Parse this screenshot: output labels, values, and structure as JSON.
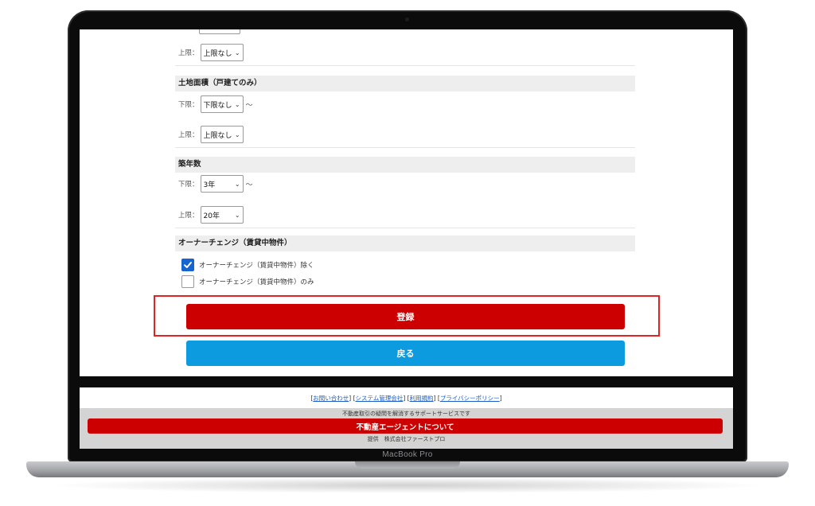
{
  "device": {
    "label": "MacBook Pro"
  },
  "form": {
    "top_row": {
      "label": "上限：",
      "value": "上限なし"
    },
    "land_area": {
      "heading": "土地面積（戸建てのみ）",
      "lower": {
        "label": "下限：",
        "value": "下限なし",
        "suffix": "〜"
      },
      "upper": {
        "label": "上限：",
        "value": "上限なし"
      }
    },
    "building_age": {
      "heading": "築年数",
      "lower": {
        "label": "下限：",
        "value": "3年",
        "suffix": "〜"
      },
      "upper": {
        "label": "上限：",
        "value": "20年"
      }
    },
    "owner_change": {
      "heading": "オーナーチェンジ（賃貸中物件）",
      "options": [
        {
          "label": "オーナーチェンジ（賃貸中物件）除く",
          "checked": true
        },
        {
          "label": "オーナーチェンジ（賃貸中物件）のみ",
          "checked": false
        }
      ]
    }
  },
  "buttons": {
    "register": "登録",
    "back": "戻る"
  },
  "footer": {
    "links": [
      "お問い合わせ",
      "システム管理会社",
      "利用規約",
      "プライバシーポリシー"
    ],
    "support_text": "不動産取引の疑問を解消するサポートサービスです",
    "agent_bar": "不動産エージェントについて",
    "provider": "提供　株式会社ファーストプロ"
  },
  "colors": {
    "accent_red": "#cc0000",
    "back_blue": "#0d9be0",
    "check_blue": "#1464d2",
    "highlight": "#e02424"
  }
}
